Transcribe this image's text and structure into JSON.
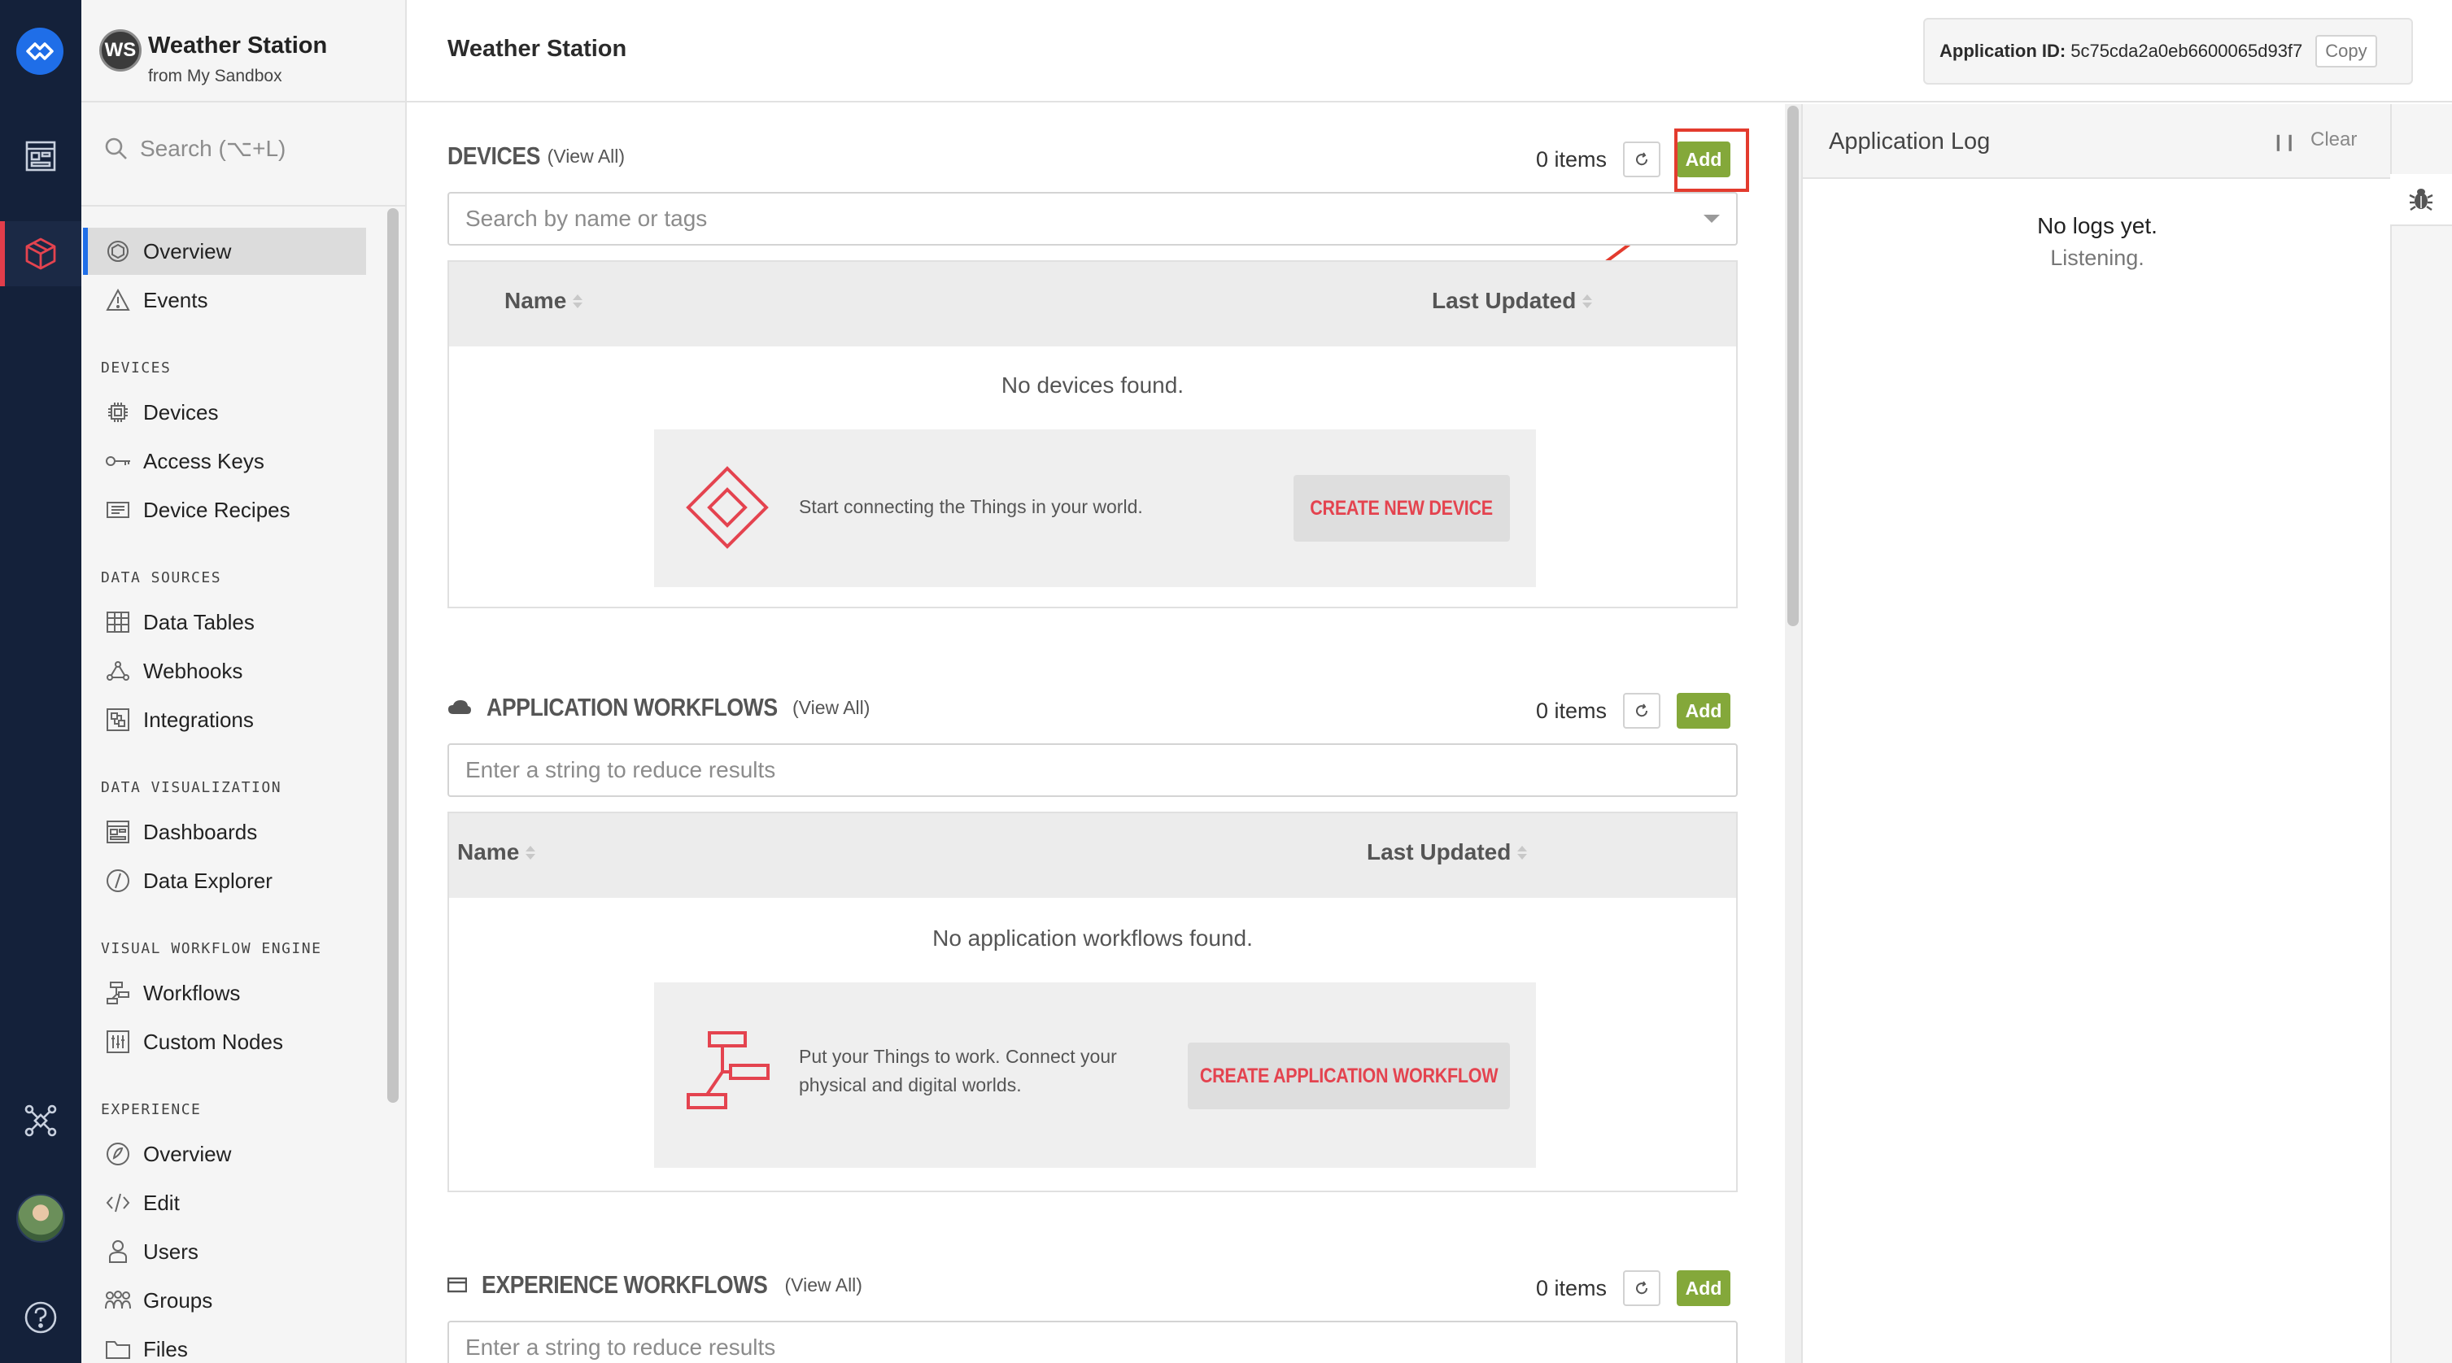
{
  "app": {
    "initials": "WS",
    "name": "Weather Station",
    "owner": "from My Sandbox"
  },
  "search": {
    "placeholder": "Search (⌥+L)"
  },
  "nav": {
    "items_top": [
      {
        "label": "Overview"
      },
      {
        "label": "Events"
      }
    ],
    "sections": [
      {
        "title": "DEVICES",
        "items": [
          {
            "label": "Devices"
          },
          {
            "label": "Access Keys"
          },
          {
            "label": "Device Recipes"
          }
        ]
      },
      {
        "title": "DATA SOURCES",
        "items": [
          {
            "label": "Data Tables"
          },
          {
            "label": "Webhooks"
          },
          {
            "label": "Integrations"
          }
        ]
      },
      {
        "title": "DATA VISUALIZATION",
        "items": [
          {
            "label": "Dashboards"
          },
          {
            "label": "Data Explorer"
          }
        ]
      },
      {
        "title": "VISUAL WORKFLOW ENGINE",
        "items": [
          {
            "label": "Workflows"
          },
          {
            "label": "Custom Nodes"
          }
        ]
      },
      {
        "title": "EXPERIENCE",
        "items": [
          {
            "label": "Overview"
          },
          {
            "label": "Edit"
          },
          {
            "label": "Users"
          },
          {
            "label": "Groups"
          },
          {
            "label": "Files"
          }
        ]
      }
    ]
  },
  "header": {
    "title": "Weather Station",
    "app_id_label": "Application ID:",
    "app_id": "5c75cda2a0eb6600065d93f7",
    "copy_label": "Copy"
  },
  "devices": {
    "title": "DEVICES",
    "view_all": "(View All)",
    "count": "0 items",
    "add_label": "Add",
    "search_placeholder": "Search by name or tags",
    "col_name": "Name",
    "col_updated": "Last Updated",
    "empty": "No devices found.",
    "cta_text": "Start connecting the Things in your world.",
    "cta_button": "CREATE NEW DEVICE"
  },
  "app_workflows": {
    "title": "APPLICATION WORKFLOWS",
    "view_all": "(View All)",
    "count": "0 items",
    "add_label": "Add",
    "search_placeholder": "Enter a string to reduce results",
    "col_name": "Name",
    "col_updated": "Last Updated",
    "empty": "No application workflows found.",
    "cta_text_1": "Put your Things to work. Connect your",
    "cta_text_2": "physical and digital worlds.",
    "cta_button": "CREATE APPLICATION WORKFLOW"
  },
  "exp_workflows": {
    "title": "EXPERIENCE WORKFLOWS",
    "view_all": "(View All)",
    "count": "0 items",
    "add_label": "Add",
    "search_placeholder": "Enter a string to reduce results"
  },
  "log": {
    "title": "Application Log",
    "pause_icon": "pause-icon",
    "clear_label": "Clear",
    "empty": "No logs yet.",
    "status": "Listening."
  },
  "colors": {
    "rail_bg": "#14213a",
    "accent_red": "#e4434f",
    "add_green": "#84a83a",
    "annotation_red": "#e33b2e"
  }
}
